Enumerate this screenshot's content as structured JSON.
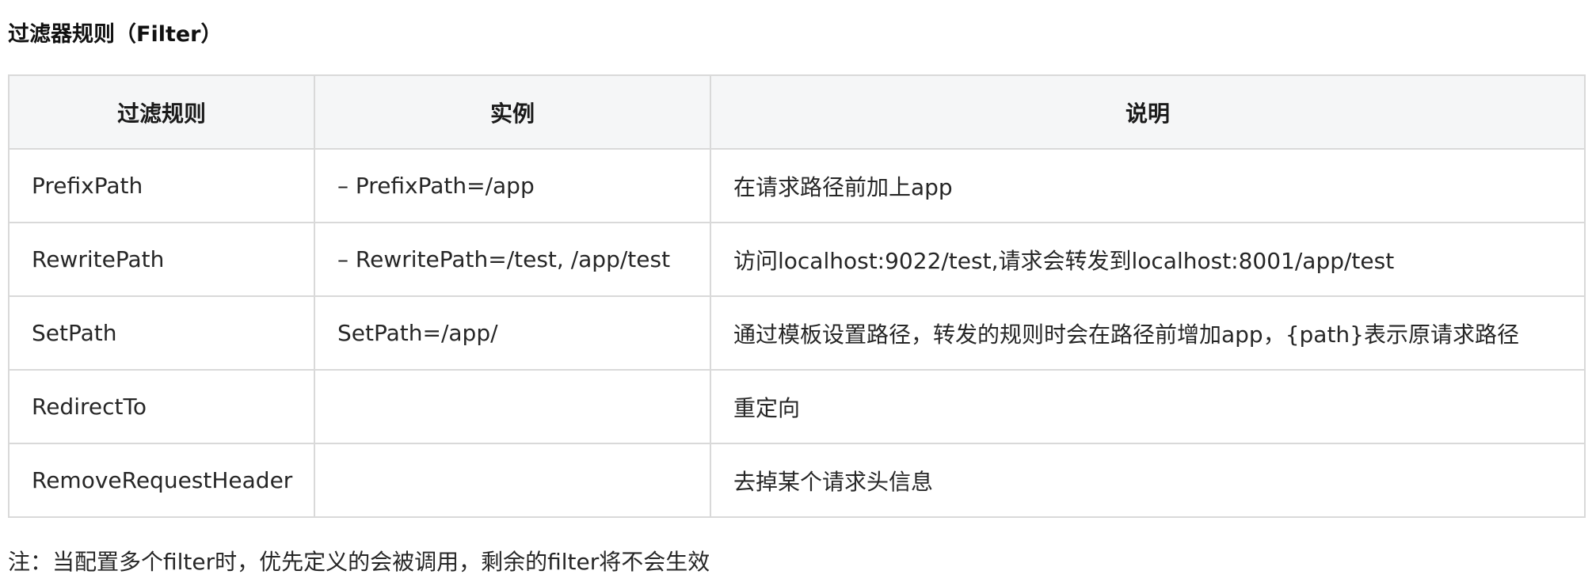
{
  "heading": "过滤器规则（Filter）",
  "table": {
    "headers": [
      "过滤规则",
      "实例",
      "说明"
    ],
    "rows": [
      {
        "rule": "PrefixPath",
        "example": "– PrefixPath=/app",
        "description": "在请求路径前加上app"
      },
      {
        "rule": "RewritePath",
        "example": "– RewritePath=/test, /app/test",
        "description": "访问localhost:9022/test,请求会转发到localhost:8001/app/test"
      },
      {
        "rule": "SetPath",
        "example": "SetPath=/app/",
        "description": "通过模板设置路径，转发的规则时会在路径前增加app，{path}表示原请求路径"
      },
      {
        "rule": "RedirectTo",
        "example": "",
        "description": "重定向"
      },
      {
        "rule": "RemoveRequestHeader",
        "example": "",
        "description": "去掉某个请求头信息"
      }
    ]
  },
  "note": "注：当配置多个filter时，优先定义的会被调用，剩余的filter将不会生效"
}
